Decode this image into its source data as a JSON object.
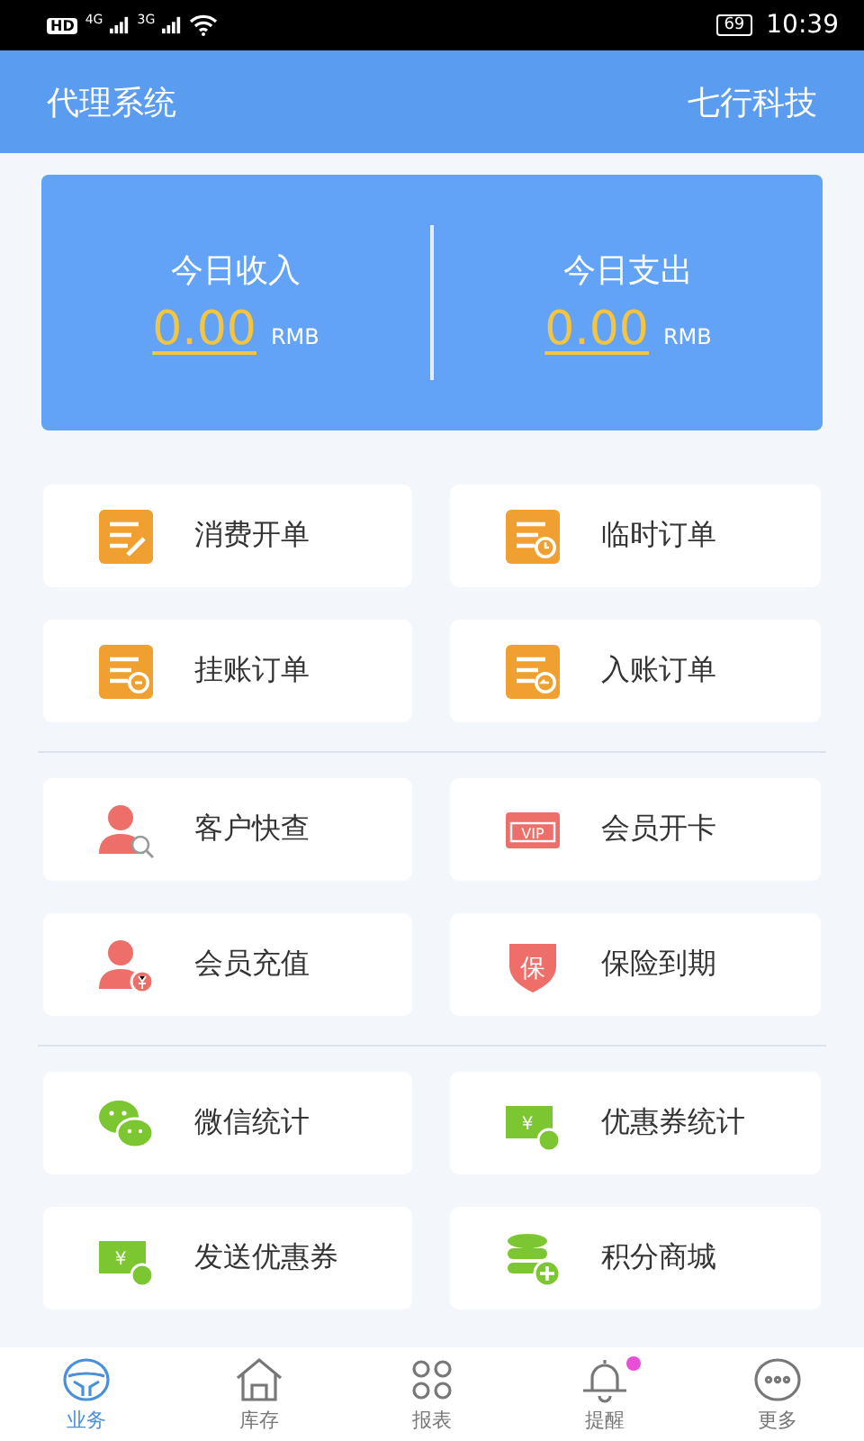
{
  "status_bar": {
    "hd": "HD",
    "net1": "4G",
    "net2": "3G",
    "battery": "69",
    "time": "10:39"
  },
  "header": {
    "title": "代理系统",
    "company": "七行科技"
  },
  "summary": [
    {
      "label": "今日收入",
      "amount": "0.00",
      "unit": "RMB"
    },
    {
      "label": "今日支出",
      "amount": "0.00",
      "unit": "RMB"
    }
  ],
  "groups": [
    {
      "color": "#f0a030",
      "items": [
        {
          "label": "消费开单",
          "kind": "doc-pen"
        },
        {
          "label": "临时订单",
          "kind": "doc-clock"
        },
        {
          "label": "挂账订单",
          "kind": "doc-minus"
        },
        {
          "label": "入账订单",
          "kind": "doc-back"
        }
      ]
    },
    {
      "color": "#ee6f6a",
      "items": [
        {
          "label": "客户快查",
          "kind": "user-search"
        },
        {
          "label": "会员开卡",
          "kind": "vip-card",
          "icon_text": "VIP"
        },
        {
          "label": "会员充值",
          "kind": "user-coin"
        },
        {
          "label": "保险到期",
          "kind": "shield",
          "icon_text": "保"
        }
      ]
    },
    {
      "color": "#7bc631",
      "items": [
        {
          "label": "微信统计",
          "kind": "chat"
        },
        {
          "label": "优惠券统计",
          "kind": "coupon",
          "icon_text": "¥"
        },
        {
          "label": "发送优惠券",
          "kind": "coupon",
          "icon_text": "¥"
        },
        {
          "label": "积分商城",
          "kind": "coins"
        }
      ]
    }
  ],
  "tabs": [
    {
      "label": "业务",
      "kind": "wheel",
      "selected": true,
      "badge": false
    },
    {
      "label": "库存",
      "kind": "house",
      "selected": false,
      "badge": false
    },
    {
      "label": "报表",
      "kind": "grid",
      "selected": false,
      "badge": false
    },
    {
      "label": "提醒",
      "kind": "bell",
      "selected": false,
      "badge": true
    },
    {
      "label": "更多",
      "kind": "more",
      "selected": false,
      "badge": false
    }
  ]
}
